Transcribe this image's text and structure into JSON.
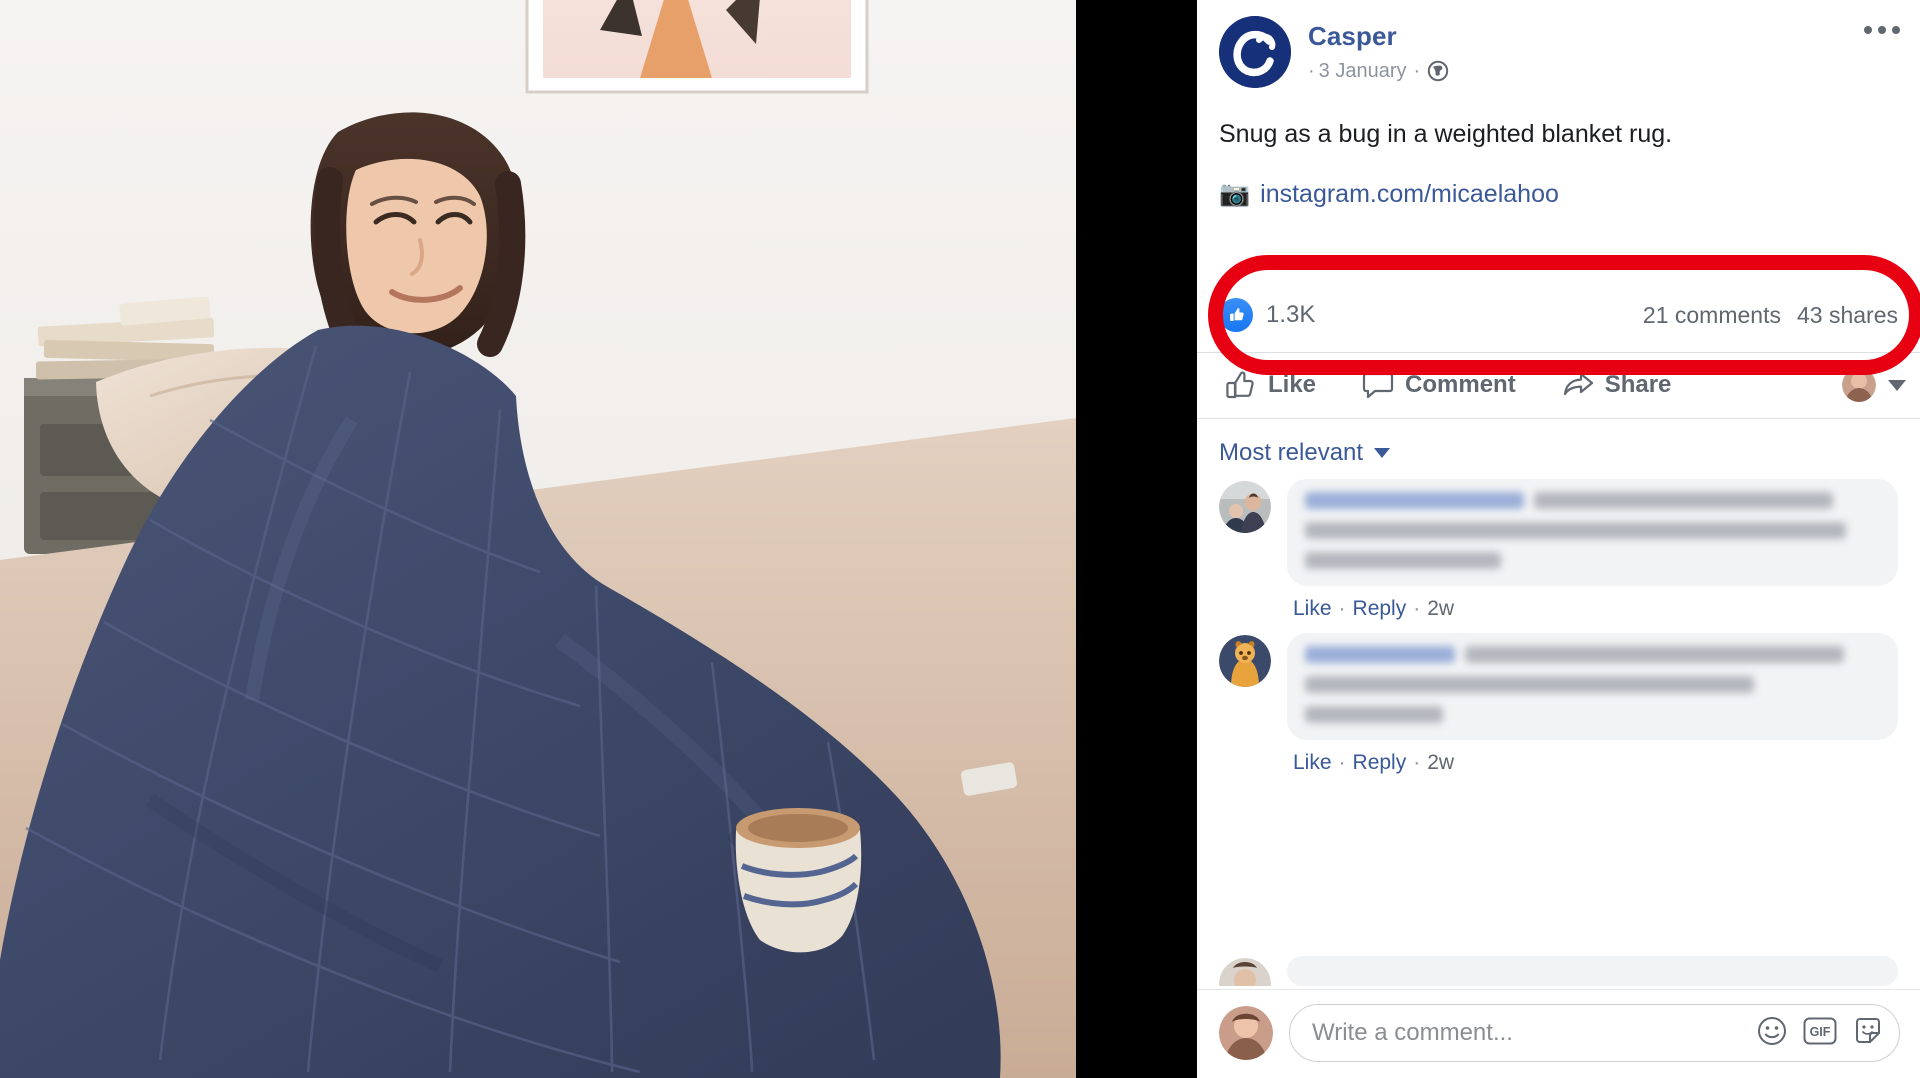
{
  "photo": {
    "alt": "Woman wrapped in a navy quilted weighted blanket sitting on a bed",
    "scene": {
      "wall_color": "#f2efec",
      "blanket_color": "#3f4a6b",
      "bedding_color": "#d9c3b2",
      "plant_leaf_color": "#7ba05b",
      "art_frame_colors": [
        "#f6e3dd",
        "#e8a06a",
        "#4a3b35"
      ],
      "mug_colors": [
        "#c89a72",
        "#e8e2d6",
        "#3b4f86"
      ],
      "nightstand_color": "#6b6a62"
    }
  },
  "post": {
    "page_name": "Casper",
    "avatar_icon": "casper-logo",
    "meta_lead_dot": "·",
    "date": "3 January",
    "meta_separator": "·",
    "privacy_icon": "globe-icon",
    "more_menu_icon": "ellipsis-icon",
    "body_text": "Snug as a bug in a weighted blanket rug.",
    "link": {
      "icon": "camera-icon",
      "emoji": "📷",
      "text": "instagram.com/micaelahoo"
    }
  },
  "stats": {
    "reaction_icon": "thumbs-up-icon",
    "reaction_count": "1.3K",
    "comments": "21 comments",
    "shares": "43 shares",
    "highlight_color": "#e60012"
  },
  "actions": {
    "like": {
      "label": "Like",
      "icon": "thumbs-up-outline-icon"
    },
    "comment": {
      "label": "Comment",
      "icon": "speech-bubble-icon"
    },
    "share": {
      "label": "Share",
      "icon": "share-arrow-icon"
    },
    "profile_caret_icon": "chevron-down-icon"
  },
  "sort": {
    "label": "Most relevant",
    "caret_icon": "chevron-down-icon"
  },
  "comments": [
    {
      "avatar": "couple-photo-avatar",
      "redacted": true,
      "name_redacted_widths": [
        "38%",
        "44%"
      ],
      "body_redacted_widths": [
        "30%",
        "94%",
        "34%"
      ],
      "like": "Like",
      "separator": "·",
      "reply": "Reply",
      "age": "2w"
    },
    {
      "avatar": "dog-costume-avatar",
      "redacted": true,
      "name_redacted_widths": [
        "22%",
        "26%"
      ],
      "body_redacted_widths": [
        "47%",
        "78%",
        "24%"
      ],
      "like": "Like",
      "separator": "·",
      "reply": "Reply",
      "age": "2w"
    }
  ],
  "composer": {
    "avatar": "user-photo-avatar",
    "placeholder": "Write a comment...",
    "value": "",
    "icons": [
      {
        "name": "emoji-icon",
        "label": "☺"
      },
      {
        "name": "gif-icon",
        "label": "GIF"
      },
      {
        "name": "sticker-icon",
        "label": "sticker"
      }
    ]
  },
  "colors": {
    "fb_blue": "#3b5998",
    "reaction_blue": "#1877f2",
    "text_primary": "#1c1e21",
    "text_secondary": "#606770",
    "bubble_bg": "#f2f3f5",
    "divider": "#dddfe2",
    "gutter": "#000000"
  }
}
